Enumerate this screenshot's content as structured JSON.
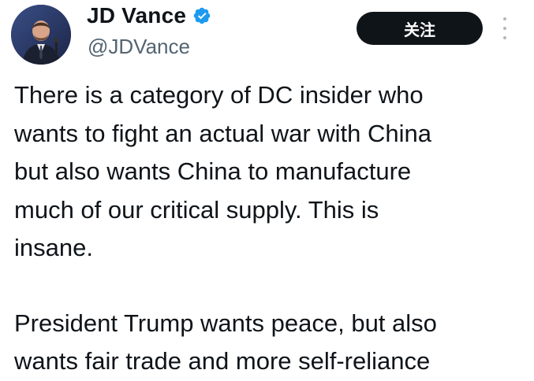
{
  "author": {
    "display_name": "JD Vance",
    "handle": "@JDVance",
    "verified": true,
    "verified_color": "#1d9bf0"
  },
  "actions": {
    "follow_label": "关注",
    "more_icon": "more-vertical-icon"
  },
  "tweet": {
    "paragraphs": [
      "There is a category of DC insider who\nwants to fight an actual war with China\nbut also wants China to manufacture\nmuch of our critical supply. This is\ninsane.",
      "President Trump wants peace, but also\nwants fair trade and more self-reliance"
    ]
  }
}
